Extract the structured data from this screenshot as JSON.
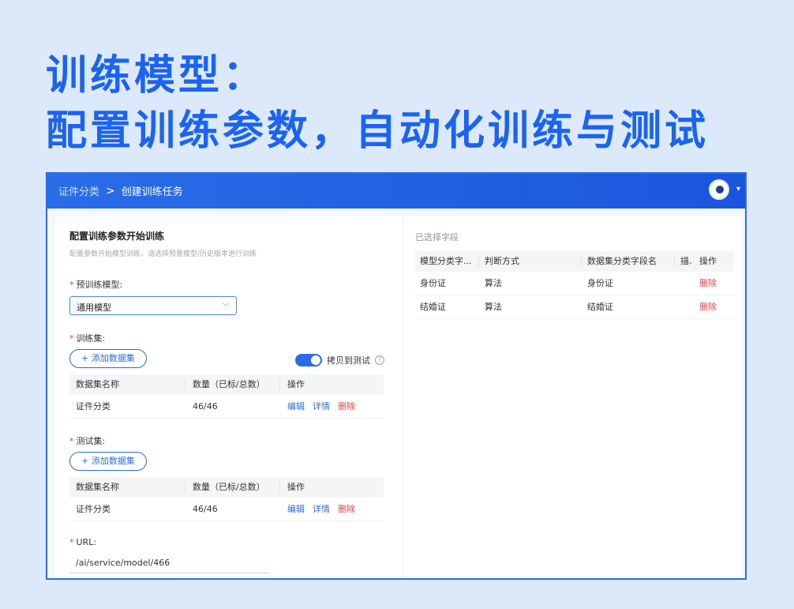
{
  "headline": {
    "line1": "训练模型：",
    "line2": "配置训练参数，自动化训练与测试"
  },
  "breadcrumb": {
    "parent": "证件分类",
    "separator": ">",
    "current": "创建训练任务"
  },
  "header_icons": [
    "avatar-icon",
    "caret-down-icon"
  ],
  "form": {
    "title": "配置训练参数开始训练",
    "subtitle": "配置参数开始模型训练，请选择预置模型/历史版本进行训练",
    "model_label": "预训练模型:",
    "model_value": "通用模型",
    "train_label": "训练集:",
    "add_train_btn": "+ 添加数据集",
    "toggle_label": "拷贝到测试",
    "test_label": "测试集:",
    "add_test_btn": "+ 添加数据集",
    "url_label": "URL:",
    "url_value": "/ai/service/model/466"
  },
  "train_table": {
    "headers": [
      "数据集名称",
      "数量（已标/总数）",
      "操作"
    ],
    "rows": [
      {
        "name": "证件分类",
        "count": "46/46",
        "edit": "编辑",
        "detail": "详情",
        "delete": "删除"
      }
    ]
  },
  "test_table": {
    "headers": [
      "数据集名称",
      "数量（已标/总数）",
      "操作"
    ],
    "rows": [
      {
        "name": "证件分类",
        "count": "46/46",
        "edit": "编辑",
        "detail": "详情",
        "delete": "删除"
      }
    ]
  },
  "selected_fields": {
    "title": "已选择字段",
    "headers": [
      "模型分类字...",
      "判断方式",
      "数据集分类字段名",
      "描.",
      "操作"
    ],
    "rows": [
      {
        "model_field": "身份证",
        "method": "算法",
        "dataset_field": "身份证",
        "delete": "删除"
      },
      {
        "model_field": "结婚证",
        "method": "算法",
        "dataset_field": "结婚证",
        "delete": "删除"
      }
    ]
  },
  "colors": {
    "accent": "#2d6be6",
    "headline": "#1b63f0",
    "danger": "#f04a4a",
    "background": "#dbe9fb"
  }
}
